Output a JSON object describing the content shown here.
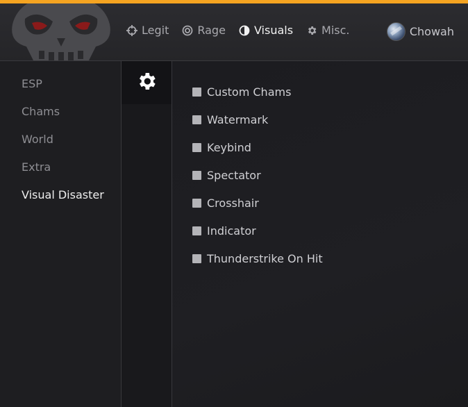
{
  "colors": {
    "accent": "#f5a421",
    "active_text": "#f2f2f2",
    "inactive_text": "#a9a9ae",
    "checkbox": "#b4b4b8"
  },
  "header": {
    "nav": [
      {
        "label": "Legit",
        "icon": "crosshair-icon"
      },
      {
        "label": "Rage",
        "icon": "target-icon"
      },
      {
        "label": "Visuals",
        "icon": "half-circle-icon",
        "active": true
      },
      {
        "label": "Misc.",
        "icon": "gear-icon"
      }
    ],
    "user": {
      "name": "Chowah"
    }
  },
  "sidebar": {
    "items": [
      {
        "label": "ESP"
      },
      {
        "label": "Chams"
      },
      {
        "label": "World"
      },
      {
        "label": "Extra"
      },
      {
        "label": "Visual Disaster",
        "active": true
      }
    ]
  },
  "subnav": {
    "tabs": [
      {
        "icon": "gear-icon",
        "active": true
      }
    ]
  },
  "content": {
    "options": [
      {
        "label": "Custom Chams",
        "checked": false
      },
      {
        "label": "Watermark",
        "checked": false
      },
      {
        "label": "Keybind",
        "checked": false
      },
      {
        "label": "Spectator",
        "checked": false
      },
      {
        "label": "Crosshair",
        "checked": false
      },
      {
        "label": "Indicator",
        "checked": false
      },
      {
        "label": "Thunderstrike On Hit",
        "checked": false
      }
    ]
  }
}
